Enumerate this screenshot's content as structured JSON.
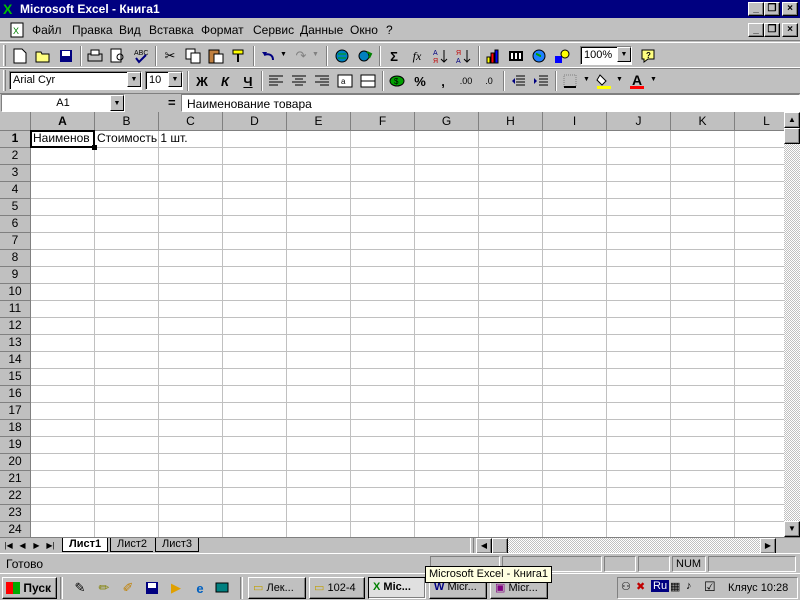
{
  "window": {
    "title": "Microsoft Excel - Книга1"
  },
  "menu": [
    "Файл",
    "Правка",
    "Вид",
    "Вставка",
    "Формат",
    "Сервис",
    "Данные",
    "Окно",
    "?"
  ],
  "toolbar": {
    "zoom": "100%",
    "font": "Arial Cyr",
    "font_size": "10",
    "bold": "Ж",
    "italic": "К",
    "underline": "Ч",
    "sum": "Σ",
    "fx": "fx",
    "percent": "%",
    "comma": ",",
    "font_color_letter": "A"
  },
  "formula_bar": {
    "name_box": "A1",
    "equals": "=",
    "content": "Наименование товара"
  },
  "columns": [
    "A",
    "B",
    "C",
    "D",
    "E",
    "F",
    "G",
    "H",
    "I",
    "J",
    "K",
    "L"
  ],
  "rows": [
    "1",
    "2",
    "3",
    "4",
    "5",
    "6",
    "7",
    "8",
    "9",
    "10",
    "11",
    "12",
    "13",
    "14",
    "15",
    "16",
    "17",
    "18",
    "19",
    "20",
    "21",
    "22",
    "23",
    "24"
  ],
  "cells": {
    "A1": "Наименов",
    "B1": "Стоимость 1 шт."
  },
  "sheets": [
    "Лист1",
    "Лист2",
    "Лист3"
  ],
  "status": {
    "ready": "Готово",
    "num": "NUM"
  },
  "taskbar": {
    "start": "Пуск",
    "buttons": [
      "Лек...",
      "102-4",
      "Mic...",
      "Micr...",
      "Micr..."
    ],
    "tray_lang": "Ru",
    "tray_clock": "Кляус 10:28",
    "tooltip": "Microsoft Excel - Книга1"
  },
  "colors": {
    "title_bg": "#000080",
    "face": "#c0c0c0",
    "grid": "#c0c0c0"
  }
}
